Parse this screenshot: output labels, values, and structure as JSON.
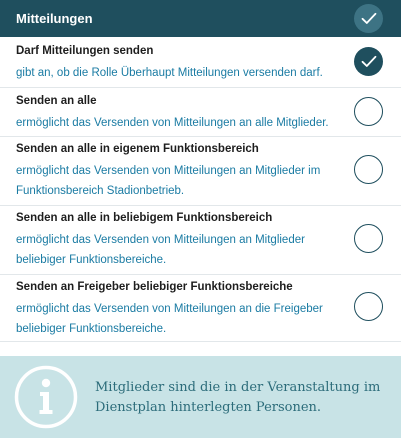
{
  "header": {
    "title": "Mitteilungen",
    "all_checked": true
  },
  "permissions": [
    {
      "title": "Darf Mitteilungen senden",
      "description": "gibt an, ob die Rolle Überhaupt Mitteilungen versenden darf.",
      "checked": true
    },
    {
      "title": "Senden an alle",
      "description": "ermöglicht das Versenden von Mitteilungen an alle Mitglieder.",
      "checked": false
    },
    {
      "title": "Senden an alle in eigenem Funktionsbereich",
      "description": "ermöglicht das Versenden von Mitteilungen an Mitglieder im Funktionsbereich Stadionbetrieb.",
      "checked": false
    },
    {
      "title": "Senden an alle in beliebigem Funktionsbereich",
      "description": "ermöglicht das Versenden von Mitteilungen an Mitglieder beliebiger Funktionsbereiche.",
      "checked": false
    },
    {
      "title": "Senden an Freigeber beliebiger Funktionsbereiche",
      "description": "ermöglicht das Versenden von Mitteilungen an die Freigeber beliebiger Funktionsbereiche.",
      "checked": false
    }
  ],
  "info": {
    "icon": "info-icon",
    "text": "Mitglieder sind die in der Veranstaltung im Dienstplan hinterlegten Personen."
  },
  "colors": {
    "header_bg": "#1f4f5e",
    "accent": "#1a7ba3",
    "info_bg": "#c8e3e6"
  }
}
